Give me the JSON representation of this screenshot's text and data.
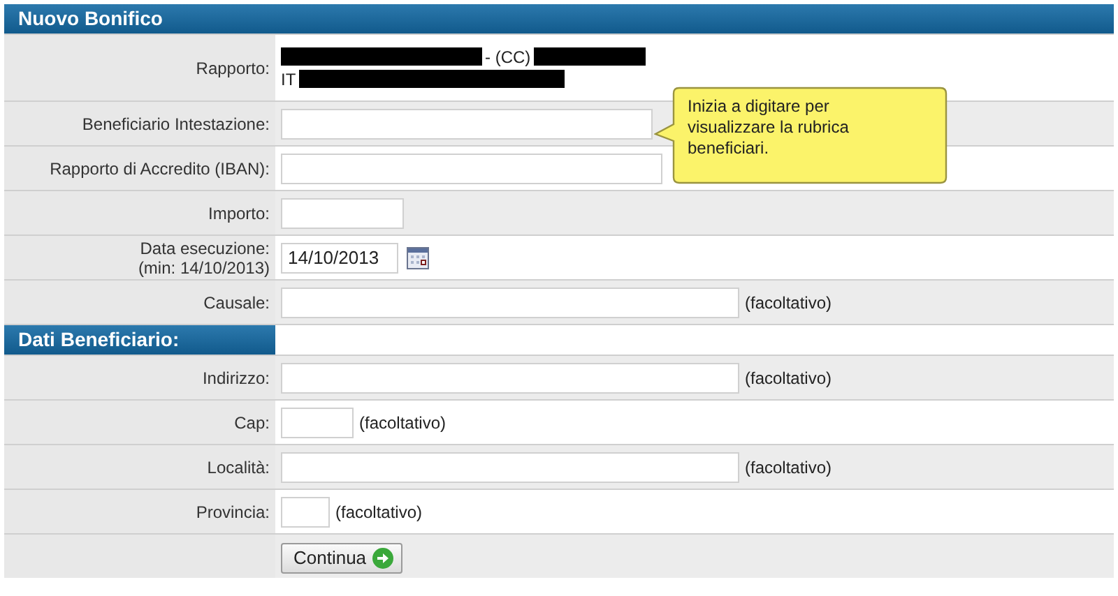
{
  "title": "Nuovo Bonifico",
  "rows": [
    {
      "kind": "account",
      "label": "Rapporto:",
      "account_type": "- (CC)",
      "country": "IT"
    },
    {
      "kind": "field",
      "label": "Beneficiario Intestazione:",
      "tooltip": "Inizia a digitare per visualizzare la rubrica beneficiari."
    },
    {
      "kind": "field",
      "label": "Rapporto di Accredito (IBAN):"
    },
    {
      "kind": "field",
      "label": "Importo:"
    },
    {
      "kind": "date",
      "label": "Data esecuzione:",
      "label_note": "(min: 14/10/2013)",
      "value": "14/10/2013"
    },
    {
      "kind": "field",
      "label": "Causale:",
      "note": "(facoltativo)"
    },
    {
      "kind": "section",
      "label": "Dati Beneficiario:"
    },
    {
      "kind": "field",
      "label": "Indirizzo:",
      "note": "(facoltativo)"
    },
    {
      "kind": "field",
      "label": "Cap:",
      "note": "(facoltativo)"
    },
    {
      "kind": "field",
      "label": "Località:",
      "note": "(facoltativo)"
    },
    {
      "kind": "field",
      "label": "Provincia:",
      "note": "(facoltativo)"
    }
  ],
  "button": "Continua"
}
